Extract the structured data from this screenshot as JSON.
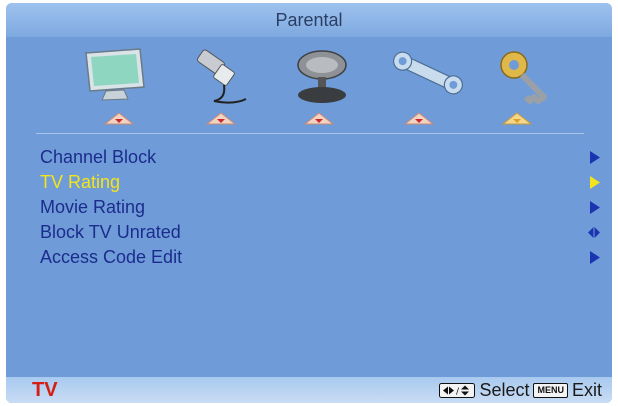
{
  "header": {
    "title": "Parental"
  },
  "tabs": [
    {
      "icon": "monitor-icon"
    },
    {
      "icon": "cable-connector-icon"
    },
    {
      "icon": "satellite-dish-icon"
    },
    {
      "icon": "wrench-setup-icon"
    },
    {
      "icon": "key-icon",
      "selected": true
    }
  ],
  "menu": {
    "items": [
      {
        "label": "Channel Block",
        "arrow": "right"
      },
      {
        "label": "TV Rating",
        "arrow": "right",
        "selected": true
      },
      {
        "label": "Movie Rating",
        "arrow": "right"
      },
      {
        "label": "Block TV Unrated",
        "arrow": "left-right"
      },
      {
        "label": "Access Code Edit",
        "arrow": "right"
      }
    ]
  },
  "footer": {
    "source": "TV",
    "select_label": "Select",
    "menu_key": "MENU",
    "exit_label": "Exit"
  },
  "colors": {
    "background": "#6f9cd8",
    "menu_text": "#1b2c8c",
    "selected_text": "#f4e41a",
    "source_text": "#d61d14"
  }
}
